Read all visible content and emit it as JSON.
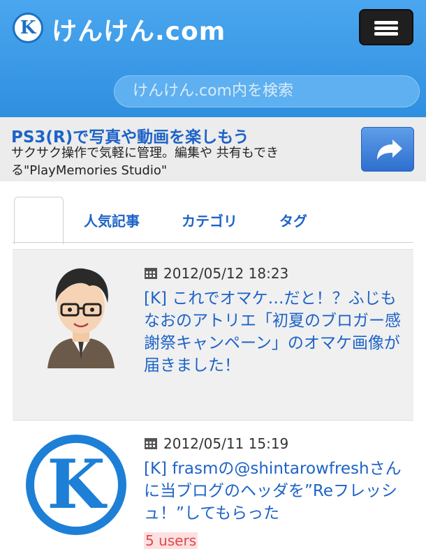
{
  "header": {
    "logo_letter": "K",
    "site_title": "けんけん.com",
    "search_placeholder": "けんけん.com内を検索"
  },
  "ad": {
    "title": "PS3(R)で写真や動画を楽しもう",
    "description": "サクサク操作で気軽に管理。編集や 共有もできる\"PlayMemories Studio\""
  },
  "tabs": [
    "",
    "人気記事",
    "カテゴリ",
    "タグ"
  ],
  "posts": [
    {
      "date": "2012/05/12 18:23",
      "title": "[K] これでオマケ…だと！？ふじもなおのアトリエ「初夏のブロガー感謝祭キャンペーン」のオマケ画像が届きました！"
    },
    {
      "date": "2012/05/11 15:19",
      "title": "[K] frasmの@shintarowfreshさんに当ブログのヘッダを”Reフレッシュ！”してもらった",
      "users": "5 users"
    }
  ],
  "colors": {
    "header_blue": "#3a9ae8",
    "link_blue": "#1d63c7",
    "badge_red": "#e0484a"
  }
}
